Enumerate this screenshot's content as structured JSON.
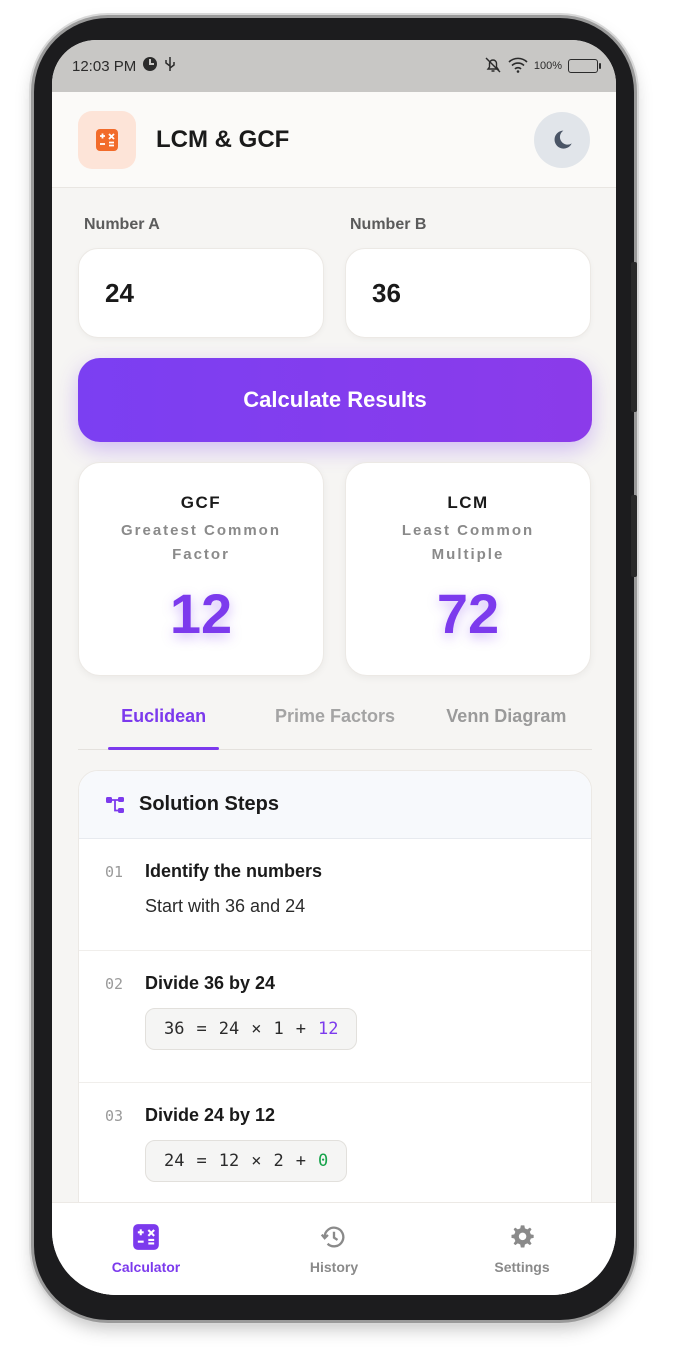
{
  "status_bar": {
    "time": "12:03 PM",
    "battery": "100%"
  },
  "header": {
    "title": "LCM & GCF"
  },
  "inputs": {
    "a": {
      "label": "Number A",
      "value": "24"
    },
    "b": {
      "label": "Number B",
      "value": "36"
    }
  },
  "calculate_label": "Calculate Results",
  "results": {
    "gcf": {
      "title": "GCF",
      "subtitle": "Greatest Common Factor",
      "value": "12"
    },
    "lcm": {
      "title": "LCM",
      "subtitle": "Least Common Multiple",
      "value": "72"
    }
  },
  "tabs": [
    {
      "label": "Euclidean",
      "active": true
    },
    {
      "label": "Prime Factors",
      "active": false
    },
    {
      "label": "Venn Diagram",
      "active": false
    }
  ],
  "steps": {
    "title": "Solution Steps",
    "items": [
      {
        "num": "01",
        "title": "Identify the numbers",
        "desc": "Start with 36 and 24"
      },
      {
        "num": "02",
        "title": "Divide 36 by 24",
        "equation": {
          "dividend": "36",
          "eq": "=",
          "divisor": "24",
          "times": "×",
          "quotient": "1",
          "plus": "+",
          "remainder": "12"
        }
      },
      {
        "num": "03",
        "title": "Divide 24 by 12",
        "equation": {
          "dividend": "24",
          "eq": "=",
          "divisor": "12",
          "times": "×",
          "quotient": "2",
          "plus": "+",
          "remainder": "0"
        }
      }
    ]
  },
  "nav": [
    {
      "label": "Calculator",
      "icon": "calculator-icon",
      "active": true
    },
    {
      "label": "History",
      "icon": "history-icon",
      "active": false
    },
    {
      "label": "Settings",
      "icon": "gear-icon",
      "active": false
    }
  ],
  "colors": {
    "accent": "#7c3aed",
    "logo_orange": "#f26b2a",
    "remainder_zero": "#16a34a"
  }
}
